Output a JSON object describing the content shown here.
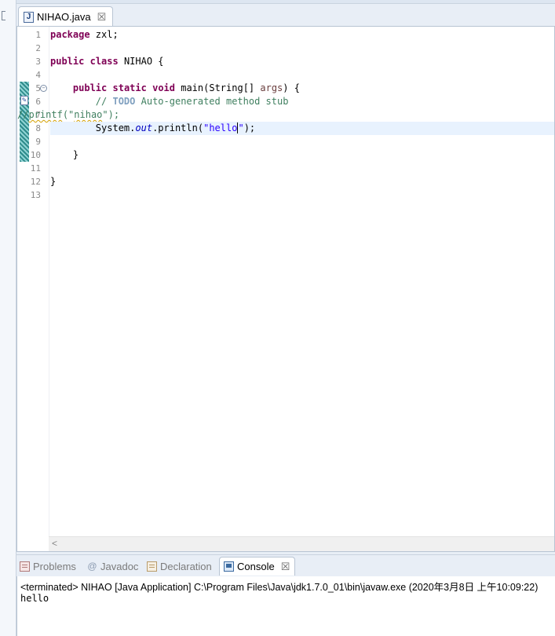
{
  "editor": {
    "tab_icon_letter": "J",
    "tab_label": "NIHAO.java",
    "close_glyph": "☒",
    "line_numbers": [
      "1",
      "2",
      "3",
      "4",
      "5",
      "6",
      "7",
      "8",
      "9",
      "10",
      "11",
      "12",
      "13"
    ],
    "code": {
      "l1_kw": "package",
      "l1_rest": " zxl;",
      "l3_kw1": "public",
      "l3_kw2": "class",
      "l3_rest": " NIHAO {",
      "l5_indent": "    ",
      "l5_kw1": "public",
      "l5_kw2": "static",
      "l5_kw3": "void",
      "l5_mid": " main(String[] ",
      "l5_var": "args",
      "l5_end": ") {",
      "l6_indent": "        ",
      "l6_slash": "// ",
      "l6_todo": "TODO",
      "l6_rest": " Auto-generated method stub",
      "l7_slash": "//",
      "l7_printf": "printf",
      "l7_open": "(\"",
      "l7_nihao": "nihao",
      "l7_close": "\");",
      "l8_indent": "        ",
      "l8_sys": "System.",
      "l8_out": "out",
      "l8_call": ".println(",
      "l8_str1": "\"hello",
      "l8_str2": "\"",
      "l8_end": ");",
      "l10": "    }",
      "l12": "}"
    },
    "scroll_arrow": "<"
  },
  "panel": {
    "tabs": {
      "problems": "Problems",
      "javadoc": "Javadoc",
      "javadoc_icon": "@",
      "declaration": "Declaration",
      "console": "Console"
    },
    "close_glyph": "☒",
    "console_header": "<terminated> NIHAO [Java Application] C:\\Program Files\\Java\\jdk1.7.0_01\\bin\\javaw.exe (2020年3月8日 上午10:09:22)",
    "console_output": "hello"
  },
  "colors": {
    "keyword": "#7f0055",
    "comment": "#3f7f5f",
    "string": "#2a00ff",
    "field": "#0000c0",
    "current_line": "#e8f2fe"
  }
}
